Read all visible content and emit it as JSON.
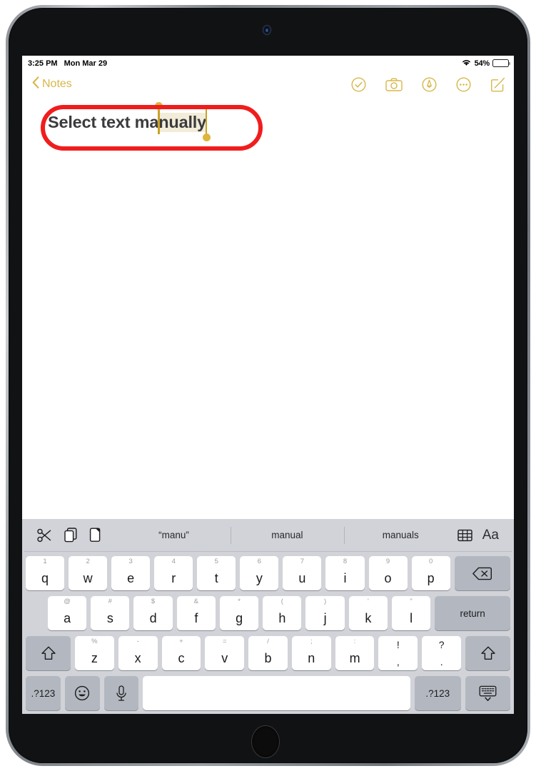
{
  "device": {
    "name": "ipad",
    "camera": "front-camera",
    "home_button": "home-button"
  },
  "status_bar": {
    "time": "3:25 PM",
    "date": "Mon Mar 29",
    "wifi_icon": "wifi-icon",
    "battery_percent": "54%",
    "battery_level": 54
  },
  "nav_bar": {
    "back_label": "Notes",
    "back_icon": "chevron-left-icon",
    "accent_color": "#d7b74a",
    "icons": [
      {
        "name": "checklist-circle-icon",
        "label": "Checklist"
      },
      {
        "name": "camera-icon",
        "label": "Camera"
      },
      {
        "name": "markup-pen-circle-icon",
        "label": "Markup"
      },
      {
        "name": "more-ellipsis-circle-icon",
        "label": "More"
      },
      {
        "name": "compose-icon",
        "label": "Compose"
      }
    ]
  },
  "note": {
    "text_before_selection": "Select text ma",
    "selected_text": "nually",
    "full_text": "Select text manually",
    "selection_highlight_color": "#f2ecd8",
    "handle_color": "#dfb53a",
    "annotation_color": "#f01d1d",
    "annotation_shape": "rounded-rectangle"
  },
  "keyboard": {
    "predictive_bar": {
      "tools": [
        {
          "name": "cut-scissors-icon",
          "label": "Cut"
        },
        {
          "name": "copy-icon",
          "label": "Copy"
        },
        {
          "name": "paste-icon",
          "label": "Paste"
        }
      ],
      "suggestions": [
        "“manu”",
        "manual",
        "manuals"
      ],
      "right_tools": [
        {
          "name": "table-icon",
          "label": "Table"
        },
        {
          "name": "text-format-icon",
          "label": "Aa"
        }
      ]
    },
    "row1": [
      {
        "alt": "1",
        "key": "q"
      },
      {
        "alt": "2",
        "key": "w"
      },
      {
        "alt": "3",
        "key": "e"
      },
      {
        "alt": "4",
        "key": "r"
      },
      {
        "alt": "5",
        "key": "t"
      },
      {
        "alt": "6",
        "key": "y"
      },
      {
        "alt": "7",
        "key": "u"
      },
      {
        "alt": "8",
        "key": "i"
      },
      {
        "alt": "9",
        "key": "o"
      },
      {
        "alt": "0",
        "key": "p"
      }
    ],
    "backspace": {
      "name": "backspace-icon",
      "label": "delete"
    },
    "row2": [
      {
        "alt": "@",
        "key": "a"
      },
      {
        "alt": "#",
        "key": "s"
      },
      {
        "alt": "$",
        "key": "d"
      },
      {
        "alt": "&",
        "key": "f"
      },
      {
        "alt": "*",
        "key": "g"
      },
      {
        "alt": "(",
        "key": "h"
      },
      {
        "alt": ")",
        "key": "j"
      },
      {
        "alt": "’",
        "key": "k"
      },
      {
        "alt": "”",
        "key": "l"
      }
    ],
    "return_label": "return",
    "row3": [
      {
        "alt": "%",
        "key": "z"
      },
      {
        "alt": "-",
        "key": "x"
      },
      {
        "alt": "+",
        "key": "c"
      },
      {
        "alt": "=",
        "key": "v"
      },
      {
        "alt": "/",
        "key": "b"
      },
      {
        "alt": ";",
        "key": "n"
      },
      {
        "alt": ":",
        "key": "m"
      }
    ],
    "row3_punct": [
      {
        "top": "!",
        "bot": ","
      },
      {
        "top": "?",
        "bot": "."
      }
    ],
    "shift_left": {
      "name": "shift-icon",
      "label": "shift"
    },
    "shift_right": {
      "name": "shift-icon",
      "label": "shift"
    },
    "row4": {
      "num_left": ".?123",
      "emoji": {
        "name": "emoji-icon",
        "label": "emoji"
      },
      "mic": {
        "name": "microphone-icon",
        "label": "dictation"
      },
      "space": "",
      "num_right": ".?123",
      "dismiss": {
        "name": "hide-keyboard-icon",
        "label": "hide keyboard"
      }
    }
  }
}
